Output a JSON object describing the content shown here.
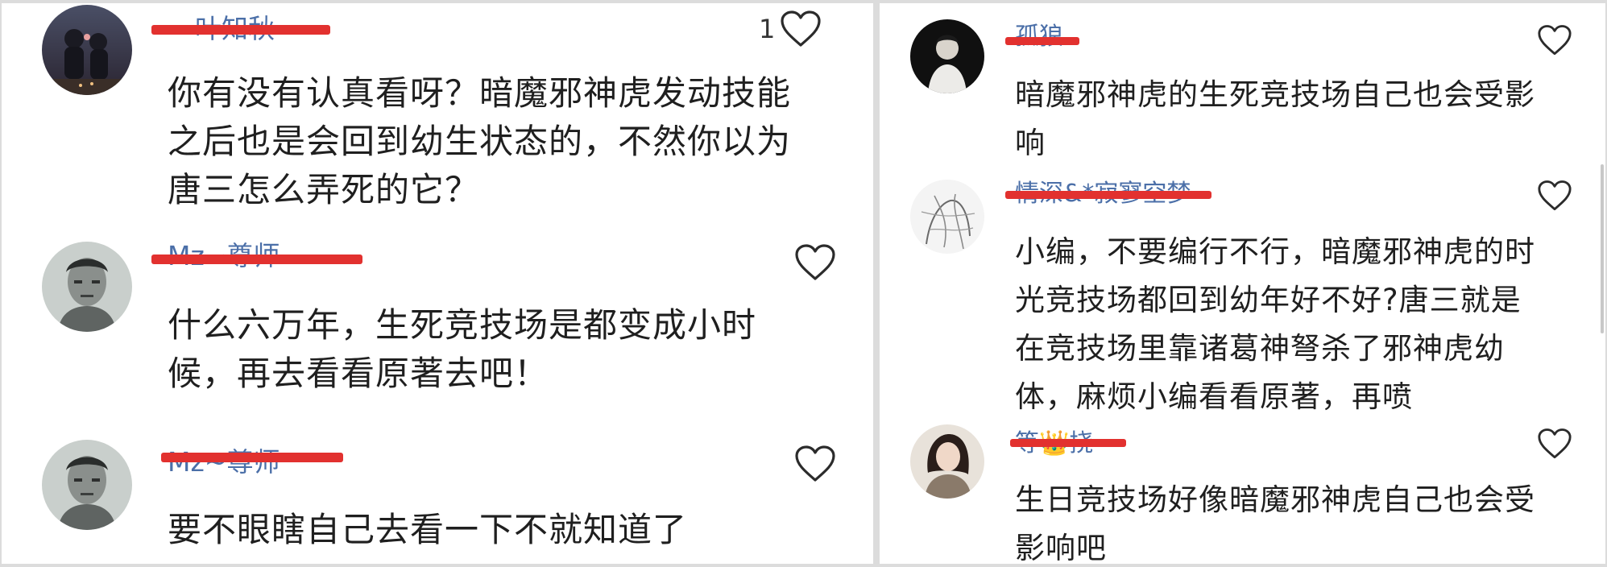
{
  "left_panel": {
    "comments": [
      {
        "username": "叶知秋",
        "text": "你有没有认真看呀？暗魔邪神虎发动技能之后也是会回到幼生状态的，不然你以为唐三怎么弄死的它？",
        "like_count": "1",
        "avatar_icon": "avatar-couple-icon"
      },
      {
        "username": "Mz~尊师",
        "text": "什么六万年，生死竞技场是都变成小时候，再去看看原著去吧！",
        "like_count": "",
        "avatar_icon": "avatar-man-icon"
      },
      {
        "username": "Mz~尊师",
        "text": "要不眼瞎自己去看一下不就知道了",
        "like_count": "",
        "avatar_icon": "avatar-man-icon"
      }
    ]
  },
  "right_panel": {
    "comments": [
      {
        "username": "孤狼",
        "text": "暗魔邪神虎的生死竞技场自己也会受影响",
        "like_count": "",
        "avatar_icon": "avatar-person-dark-icon"
      },
      {
        "username": "情深&*寂寥空梦",
        "text": "小编，不要编行不行，暗魔邪神虎的时光竞技场都回到幼年好不好?唐三就是在竞技场里靠诸葛神弩杀了邪神虎幼体，麻烦小编看看原著，再喷",
        "like_count": "",
        "avatar_icon": "avatar-sketch-icon"
      },
      {
        "username": "等👑挠",
        "text": "生日竞技场好像暗魔邪神虎自己也会受影响吧",
        "like_count": "",
        "avatar_icon": "avatar-woman-icon"
      }
    ]
  },
  "colors": {
    "username": "#4b6fa8",
    "redaction": "#e2312f",
    "text": "#1f1f1f"
  }
}
